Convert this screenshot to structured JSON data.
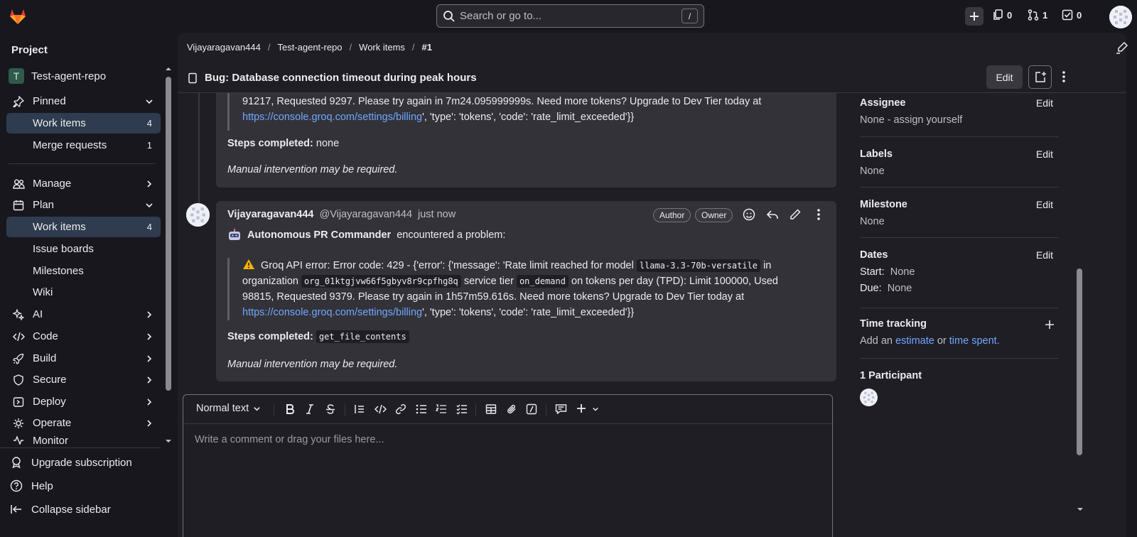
{
  "topbar": {
    "search_placeholder": "Search or go to...",
    "search_shortcut": "/",
    "issues_count": "0",
    "merge_requests_count": "1",
    "todos_count": "0"
  },
  "sidebar": {
    "title": "Project",
    "project_initial": "T",
    "project_name": "Test-agent-repo",
    "pinned_label": "Pinned",
    "pinned_items": [
      {
        "label": "Work items",
        "count": "4"
      },
      {
        "label": "Merge requests",
        "count": "1"
      }
    ],
    "manage_label": "Manage",
    "plan_label": "Plan",
    "plan_items": [
      {
        "label": "Work items",
        "count": "4"
      },
      {
        "label": "Issue boards"
      },
      {
        "label": "Milestones"
      },
      {
        "label": "Wiki"
      }
    ],
    "sections": [
      "AI",
      "Code",
      "Build",
      "Secure",
      "Deploy",
      "Operate",
      "Monitor"
    ],
    "footer": {
      "upgrade": "Upgrade subscription",
      "help": "Help",
      "collapse": "Collapse sidebar"
    }
  },
  "breadcrumb": [
    "Vijayaragavan444",
    "Test-agent-repo",
    "Work items",
    "#1"
  ],
  "issue": {
    "title": "Bug: Database connection timeout during peak hours",
    "edit_label": "Edit"
  },
  "note1": {
    "quote_line1": "91217, Requested 9297. Please try again in 7m24.095999999s. Need more tokens? Upgrade to Dev Tier today at",
    "link": "https://console.groq.com/settings/billing",
    "quote_tail": "', 'type': 'tokens', 'code': 'rate_limit_exceeded'}}",
    "steps_label": "Steps completed:",
    "steps_value": "none",
    "manual": "Manual intervention may be required."
  },
  "note2": {
    "author": "Vijayaragavan444",
    "handle": "@Vijayaragavan444",
    "time": "just now",
    "badge_author": "Author",
    "badge_owner": "Owner",
    "bot_name": "Autonomous PR Commander",
    "bot_text": "encountered a problem:",
    "error_prefix": "Groq API error: Error code: 429 - {'error': {'message': 'Rate limit reached for model",
    "model": "llama-3.3-70b-versatile",
    "in_text": "in",
    "organization_text": "organization",
    "org": "org_01ktgjvw66f5gbyv8r9cpfhg8q",
    "service_tier_text": "service tier",
    "tier": "on_demand",
    "tokens_text": "on tokens per day (TPD): Limit 100000, Used",
    "line3": "98815, Requested 9379. Please try again in 1h57m59.616s. Need more tokens? Upgrade to Dev Tier today at",
    "link": "https://console.groq.com/settings/billing",
    "quote_tail": "', 'type': 'tokens', 'code': 'rate_limit_exceeded'}}",
    "steps_label": "Steps completed:",
    "steps_value": "get_file_contents",
    "manual": "Manual intervention may be required."
  },
  "editor": {
    "format": "Normal text",
    "placeholder": "Write a comment or drag your files here..."
  },
  "right_sidebar": {
    "assignee_label": "Assignee",
    "assignee_value": "None - assign yourself",
    "labels_label": "Labels",
    "labels_value": "None",
    "milestone_label": "Milestone",
    "milestone_value": "None",
    "dates_label": "Dates",
    "start_label": "Start:",
    "start_value": "None",
    "due_label": "Due:",
    "due_value": "None",
    "time_label": "Time tracking",
    "time_add": "Add an",
    "time_estimate": "estimate",
    "time_or": "or",
    "time_spent": "time spent.",
    "participants": "1 Participant",
    "edit_label": "Edit"
  },
  "colors": {
    "accent_link": "#6fa8ff",
    "active_nav": "#2f3c4f",
    "background": "#18171d",
    "panel": "#1f1e24",
    "card": "#333238"
  }
}
